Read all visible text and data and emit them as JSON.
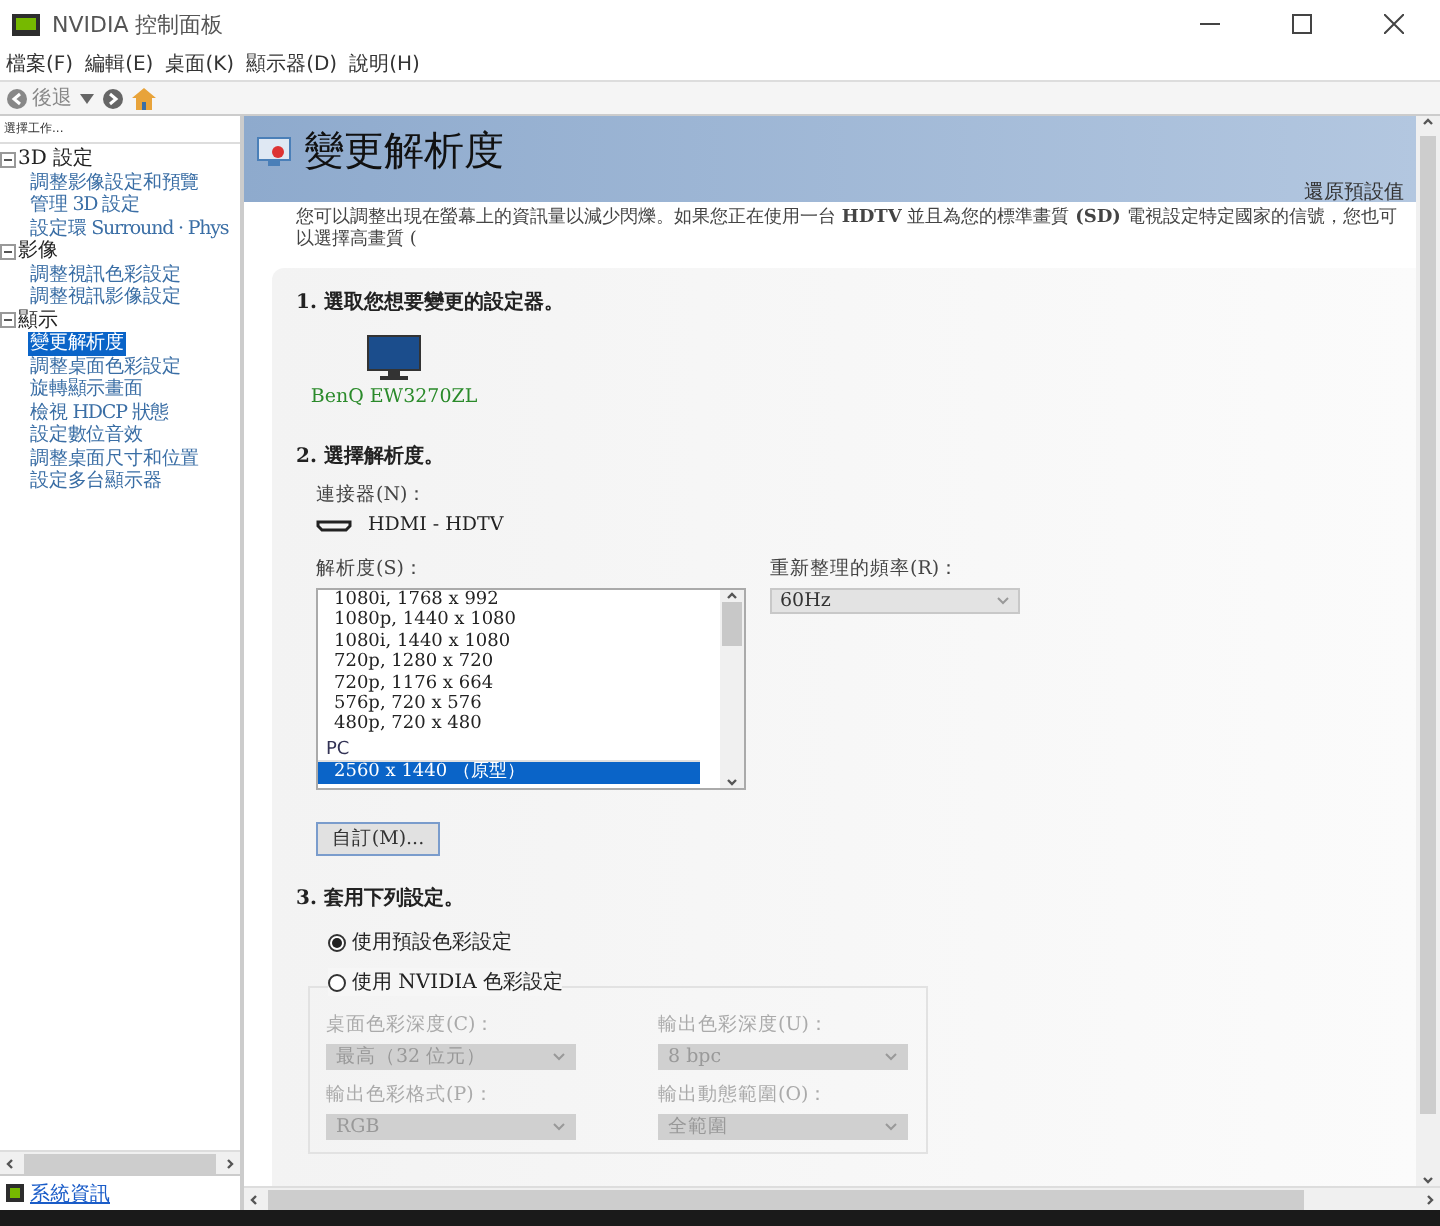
{
  "window": {
    "title": "NVIDIA 控制面板"
  },
  "menu": [
    "檔案(F)",
    "編輯(E)",
    "桌面(K)",
    "顯示器(D)",
    "說明(H)"
  ],
  "toolbar": {
    "back": "後退"
  },
  "sidebar": {
    "header": "選擇工作...",
    "tree": [
      {
        "label": "3D 設定",
        "expanded": true,
        "children": [
          {
            "label": "調整影像設定和預覽",
            "selected": false
          },
          {
            "label": "管理 3D 設定",
            "selected": false
          },
          {
            "label": "設定環 Surround · Phys",
            "selected": false
          }
        ]
      },
      {
        "label": "影像",
        "expanded": true,
        "children": [
          {
            "label": "調整視訊色彩設定",
            "selected": false
          },
          {
            "label": "調整視訊影像設定",
            "selected": false
          }
        ]
      },
      {
        "label": "顯示",
        "expanded": true,
        "children": [
          {
            "label": "變更解析度",
            "selected": true
          },
          {
            "label": "調整桌面色彩設定",
            "selected": false
          },
          {
            "label": "旋轉顯示畫面",
            "selected": false
          },
          {
            "label": "檢視 HDCP 狀態",
            "selected": false
          },
          {
            "label": "設定數位音效",
            "selected": false
          },
          {
            "label": "調整桌面尺寸和位置",
            "selected": false
          },
          {
            "label": "設定多台顯示器",
            "selected": false
          }
        ]
      }
    ],
    "footer_link": "系統資訊"
  },
  "page": {
    "title": "變更解析度",
    "restore_link": "還原預設值",
    "description": "您可以調整出現在螢幕上的資訊量以減少閃爍。如果您正在使用一台 **HDTV** 並且為您的標準畫質 **(SD)** 電視設定特定國家的信號，您也可以選擇高畫質 (",
    "section1": {
      "heading": "1. 選取您想要變更的設定器。",
      "displays": [
        {
          "name": "BenQ EW3270ZL",
          "selected": true
        }
      ]
    },
    "section2": {
      "heading": "2. 選擇解析度。",
      "connector_label": "連接器(N)：",
      "connector": "HDMI - HDTV",
      "resolution_label": "解析度(S)：",
      "resolutions": [
        {
          "kind": "item",
          "label": "1080i, 1768 x 992",
          "selected": false
        },
        {
          "kind": "item",
          "label": "1080p, 1440 x 1080",
          "selected": false
        },
        {
          "kind": "item",
          "label": "1080i, 1440 x 1080",
          "selected": false
        },
        {
          "kind": "item",
          "label": "720p, 1280 x 720",
          "selected": false
        },
        {
          "kind": "item",
          "label": "720p, 1176 x 664",
          "selected": false
        },
        {
          "kind": "item",
          "label": "576p, 720 x 576",
          "selected": false
        },
        {
          "kind": "item",
          "label": "480p, 720 x 480",
          "selected": false
        },
        {
          "kind": "group",
          "label": "PC"
        },
        {
          "kind": "item",
          "label": "2560 x 1440 （原型）",
          "selected": true
        }
      ],
      "refresh_label": "重新整理的頻率(R)：",
      "refresh_value": "60Hz",
      "custom_button": "自訂(M)..."
    },
    "section3": {
      "heading": "3. 套用下列設定。",
      "options": [
        {
          "label": "使用預設色彩設定",
          "selected": true
        },
        {
          "label": "使用 NVIDIA 色彩設定",
          "selected": false
        }
      ],
      "fields": [
        {
          "label": "桌面色彩深度(C)：",
          "value": "最高（32 位元）",
          "disabled": true
        },
        {
          "label": "輸出色彩深度(U)：",
          "value": "8 bpc",
          "disabled": true
        },
        {
          "label": "輸出色彩格式(P)：",
          "value": "RGB",
          "disabled": true
        },
        {
          "label": "輸出動態範圍(O)：",
          "value": "全範圍",
          "disabled": true
        }
      ]
    }
  }
}
